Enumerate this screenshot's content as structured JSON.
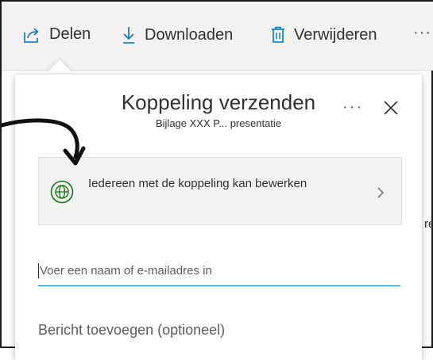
{
  "toolbar": {
    "share_label": "Delen",
    "share_icon": "share-icon",
    "download_label": "Downloaden",
    "download_icon": "download-icon",
    "delete_label": "Verwijderen",
    "delete_icon": "trash-icon",
    "more_label": "···"
  },
  "background": {
    "partial_text": "re"
  },
  "dialog": {
    "title": "Koppeling verzenden",
    "subtitle": "Bijlage XXX P... presentatie",
    "more_label": "···",
    "permission": {
      "text": "Iedereen met de koppeling kan bewerken",
      "icon": "globe-icon"
    },
    "email": {
      "placeholder": "Voer een naam of e-mailadres in"
    },
    "message": {
      "placeholder": "Bericht toevoegen (optioneel)"
    }
  },
  "colors": {
    "accent": "#0078d4",
    "globe": "#107c10",
    "toolbar_bg": "#f3f2f1",
    "icon_blue": "#0078d4"
  }
}
